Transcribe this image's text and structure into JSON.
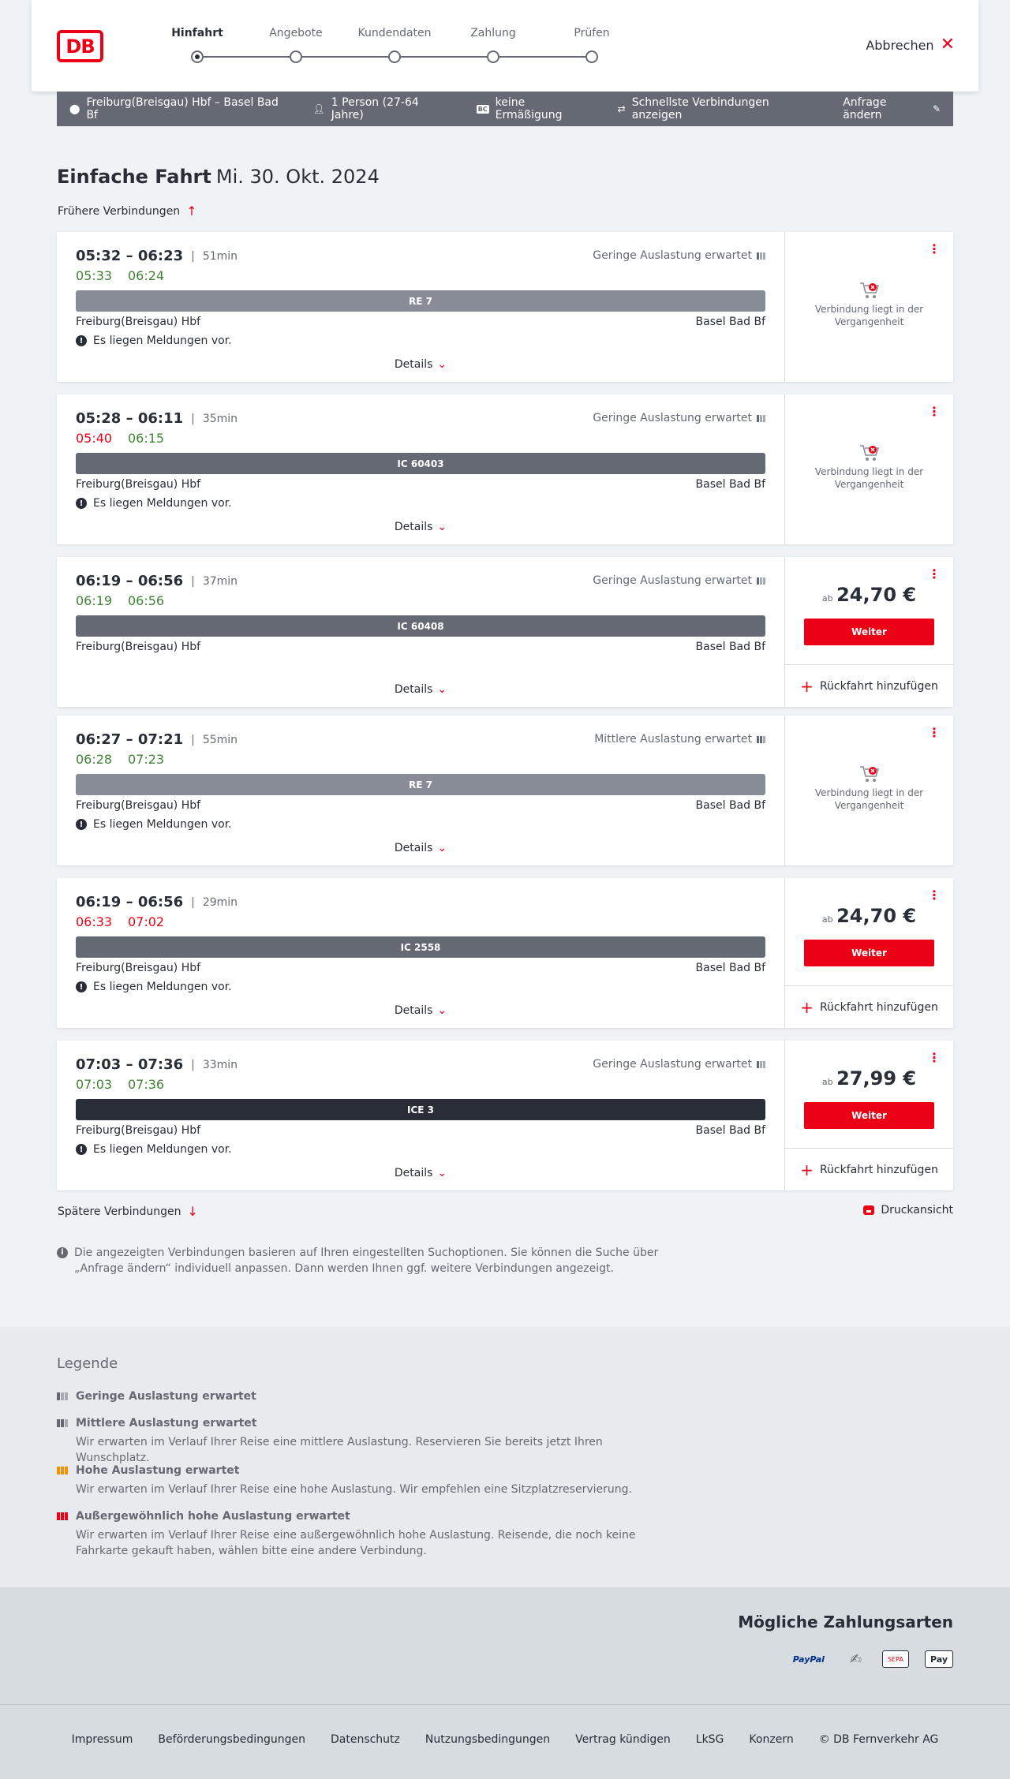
{
  "header": {
    "logo": "DB",
    "steps": [
      {
        "label": "Hinfahrt",
        "active": true
      },
      {
        "label": "Angebote",
        "active": false
      },
      {
        "label": "Kundendaten",
        "active": false
      },
      {
        "label": "Zahlung",
        "active": false
      },
      {
        "label": "Prüfen",
        "active": false
      }
    ],
    "cancel_label": "Abbrechen"
  },
  "searchbar": {
    "route": "Freiburg(Breisgau) Hbf – Basel Bad Bf",
    "persons": "1 Person (27-64 Jahre)",
    "bc_badge": "BC",
    "discount": "keine Ermäßigung",
    "fastest": "Schnellste Verbindungen anzeigen",
    "change": "Anfrage ändern"
  },
  "title": {
    "kind": "Einfache Fahrt",
    "date": "Mi. 30. Okt. 2024"
  },
  "earlier_label": "Frühere Verbindungen",
  "later_label": "Spätere Verbindungen",
  "print_label": "Druckansicht",
  "details_label": "Details",
  "notice_text": "Es liegen Meldungen vor.",
  "past_text": "Verbindung liegt in der Vergangenheit",
  "price_prefix": "ab",
  "weiter_label": "Weiter",
  "rueck_label": "Rückfahrt hinzufügen",
  "connections": [
    {
      "times": "05:32 – 06:23",
      "duration": "51min",
      "rt_dep": "05:33",
      "rt_arr": "06:24",
      "rt_dep_color": "green",
      "rt_arr_color": "green",
      "load": "Geringe Auslastung erwartet",
      "load_level": 1,
      "train": "RE 7",
      "train_color": "#878c96",
      "from": "Freiburg(Breisgau) Hbf",
      "to": "Basel Bad Bf",
      "notice": true,
      "status": "past"
    },
    {
      "times": "05:28 – 06:11",
      "duration": "35min",
      "rt_dep": "05:40",
      "rt_arr": "06:15",
      "rt_dep_color": "red",
      "rt_arr_color": "green",
      "load": "Geringe Auslastung erwartet",
      "load_level": 1,
      "train": "IC 60403",
      "train_color": "#646973",
      "from": "Freiburg(Breisgau) Hbf",
      "to": "Basel Bad Bf",
      "notice": true,
      "status": "past"
    },
    {
      "times": "06:19 – 06:56",
      "duration": "37min",
      "rt_dep": "06:19",
      "rt_arr": "06:56",
      "rt_dep_color": "green",
      "rt_arr_color": "green",
      "load": "Geringe Auslastung erwartet",
      "load_level": 1,
      "train": "IC 60408",
      "train_color": "#646973",
      "from": "Freiburg(Breisgau) Hbf",
      "to": "Basel Bad Bf",
      "notice": false,
      "status": "price",
      "price": "24,70 €"
    },
    {
      "times": "06:27 – 07:21",
      "duration": "55min",
      "rt_dep": "06:28",
      "rt_arr": "07:23",
      "rt_dep_color": "green",
      "rt_arr_color": "green",
      "load": "Mittlere Auslastung erwartet",
      "load_level": 2,
      "train": "RE 7",
      "train_color": "#878c96",
      "from": "Freiburg(Breisgau) Hbf",
      "to": "Basel Bad Bf",
      "notice": true,
      "status": "past"
    },
    {
      "times": "06:19 – 06:56",
      "duration": "29min",
      "rt_dep": "06:33",
      "rt_arr": "07:02",
      "rt_dep_color": "red",
      "rt_arr_color": "red",
      "load": "",
      "load_level": 0,
      "train": "IC 2558",
      "train_color": "#646973",
      "from": "Freiburg(Breisgau) Hbf",
      "to": "Basel Bad Bf",
      "notice": true,
      "status": "price",
      "price": "24,70 €"
    },
    {
      "times": "07:03 – 07:36",
      "duration": "33min",
      "rt_dep": "07:03",
      "rt_arr": "07:36",
      "rt_dep_color": "green",
      "rt_arr_color": "green",
      "load": "Geringe Auslastung erwartet",
      "load_level": 1,
      "train": "ICE 3",
      "train_color": "#282d37",
      "from": "Freiburg(Breisgau) Hbf",
      "to": "Basel Bad Bf",
      "notice": true,
      "status": "price",
      "price": "27,99 €"
    }
  ],
  "info_text": "Die angezeigten Verbindungen basieren auf Ihren eingestellten Suchoptionen. Sie können die Suche über „Anfrage ändern“ individuell anpassen. Dann werden Ihnen ggf. weitere Verbindungen angezeigt.",
  "legend": {
    "title": "Legende",
    "items": [
      {
        "label": "Geringe Auslastung erwartet",
        "desc": "",
        "color": "#646973",
        "filled": 1
      },
      {
        "label": "Mittlere Auslastung erwartet",
        "desc": "Wir erwarten im Verlauf Ihrer Reise eine mittlere Auslastung. Reservieren Sie bereits jetzt Ihren Wunschplatz.",
        "color": "#646973",
        "filled": 2
      },
      {
        "label": "Hohe Auslastung erwartet",
        "desc": "Wir erwarten im Verlauf Ihrer Reise eine hohe Auslastung. Wir empfehlen eine Sitzplatzreservierung.",
        "color": "#f39200",
        "filled": 3
      },
      {
        "label": "Außergewöhnlich hohe Auslastung erwartet",
        "desc": "Wir erwarten im Verlauf Ihrer Reise eine außergewöhnlich hohe Auslastung. Reisende, die noch keine Fahrkarte gekauft haben, wählen bitte eine andere Verbindung.",
        "color": "#ec0016",
        "filled": 3
      }
    ]
  },
  "payment": {
    "title": "Mögliche Zahlungsarten",
    "methods": [
      {
        "name": "paypal-icon",
        "text": "PayPal"
      },
      {
        "name": "credit-card-icon",
        "text": "✍"
      },
      {
        "name": "sepa-icon",
        "text": "SEPA"
      },
      {
        "name": "apple-pay-icon",
        "text": "Pay"
      }
    ]
  },
  "footer": {
    "links": [
      "Impressum",
      "Beförderungsbedingungen",
      "Datenschutz",
      "Nutzungsbedingungen",
      "Vertrag kündigen",
      "LkSG",
      "Konzern",
      "© DB Fernverkehr AG"
    ]
  },
  "colors": {
    "accent": "#ec0016",
    "green": "#408335",
    "dark": "#282d37",
    "grey": "#646973"
  }
}
